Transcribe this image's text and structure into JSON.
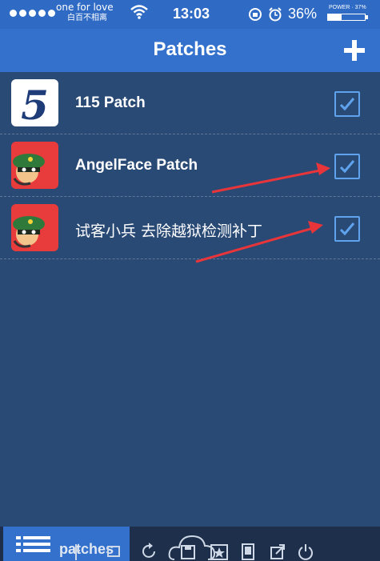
{
  "status_bar": {
    "carrier_line1": "one for love",
    "carrier_line2": "白百不相离",
    "time": "13:03",
    "battery_percent": "36%",
    "battery_label": "POWER · 37%",
    "battery_level": 0.37
  },
  "nav": {
    "title": "Patches",
    "add_icon": "plus-icon"
  },
  "patches": [
    {
      "label": "115 Patch",
      "icon": "five-logo",
      "icon_text": "5",
      "checked": true
    },
    {
      "label": "AngelFace Patch",
      "icon": "soldier-logo",
      "checked": true
    },
    {
      "label": "试客小兵 去除越狱检测补丁",
      "icon": "soldier-logo",
      "checked": true
    }
  ],
  "toolbar": {
    "active_tab_label": "patches",
    "icons": [
      "list-icon",
      "tree-icon",
      "window-icon",
      "refresh-icon",
      "cloud-icon",
      "save-icon",
      "star-icon",
      "tablet-icon",
      "export-icon",
      "power-icon"
    ]
  },
  "colors": {
    "status_bar": "#2f6bc4",
    "nav_bar": "#3471cd",
    "background": "#2a4a76",
    "checkbox": "#5fa3ee",
    "annotation_arrow": "#e8353a"
  }
}
